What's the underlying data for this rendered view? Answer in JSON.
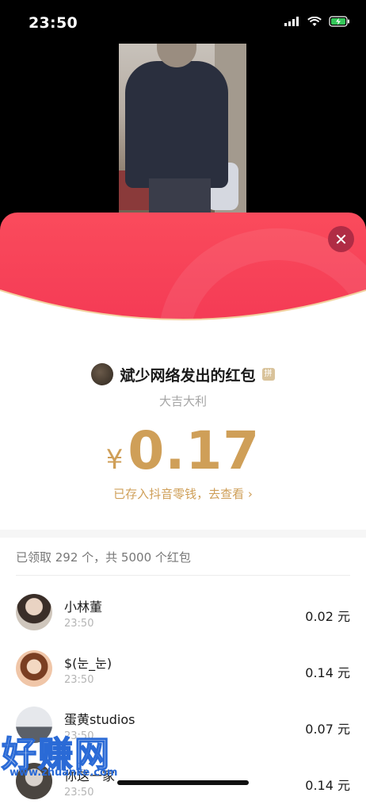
{
  "status_bar": {
    "time": "23:50"
  },
  "sender": {
    "name": "斌少网络发出的红包",
    "badge": "拼"
  },
  "greeting": "大吉大利",
  "amount": {
    "currency": "¥",
    "value": "0.17"
  },
  "wallet_link": "已存入抖音零钱，去查看 ›",
  "summary": "已领取 292 个，共 5000 个红包",
  "recipients": [
    {
      "name": "小林董",
      "time": "23:50",
      "amount": "0.02 元"
    },
    {
      "name": "$(눈_눈)",
      "time": "23:50",
      "amount": "0.14 元"
    },
    {
      "name": "蛋黄studios",
      "time": "23:50",
      "amount": "0.07 元"
    },
    {
      "name": "你这一家",
      "time": "23:50",
      "amount": "0.14 元"
    }
  ],
  "watermark": {
    "logo_text": "好赚网",
    "site": "www.zhuanke.com"
  },
  "colors": {
    "red": "#f43a55",
    "gold": "#cf9f58",
    "close_bg": "#b02c45"
  }
}
